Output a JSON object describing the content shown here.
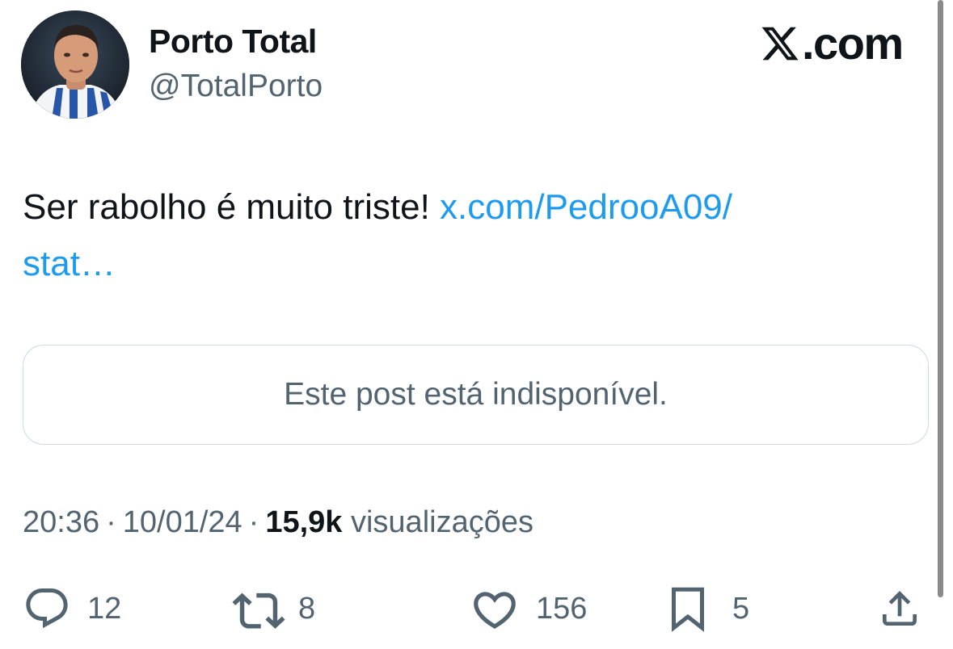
{
  "author": {
    "display_name": "Porto Total",
    "handle": "@TotalPorto",
    "avatar_icon": "profile-photo"
  },
  "brand": {
    "icon": "x-logo-icon",
    "text": ".com"
  },
  "post": {
    "text": "Ser rabolho é muito triste! ",
    "link_text": "x.com/PedrooA09/\nstat…",
    "link_color": "#1d9bf0"
  },
  "quote": {
    "unavailable_text": "Este post está indisponível."
  },
  "meta": {
    "time": "20:36",
    "separator": "·",
    "date": "10/01/24",
    "views_count": "15,9k",
    "views_label": "visualizações"
  },
  "actions": {
    "replies": {
      "icon": "reply-icon",
      "count": "12"
    },
    "reposts": {
      "icon": "repost-icon",
      "count": "8"
    },
    "likes": {
      "icon": "heart-icon",
      "count": "156"
    },
    "bookmarks": {
      "icon": "bookmark-icon",
      "count": "5"
    },
    "share": {
      "icon": "share-icon"
    }
  },
  "colors": {
    "text_primary": "#0f1419",
    "text_secondary": "#536471",
    "border": "#cfd9de",
    "link": "#1d9bf0"
  }
}
